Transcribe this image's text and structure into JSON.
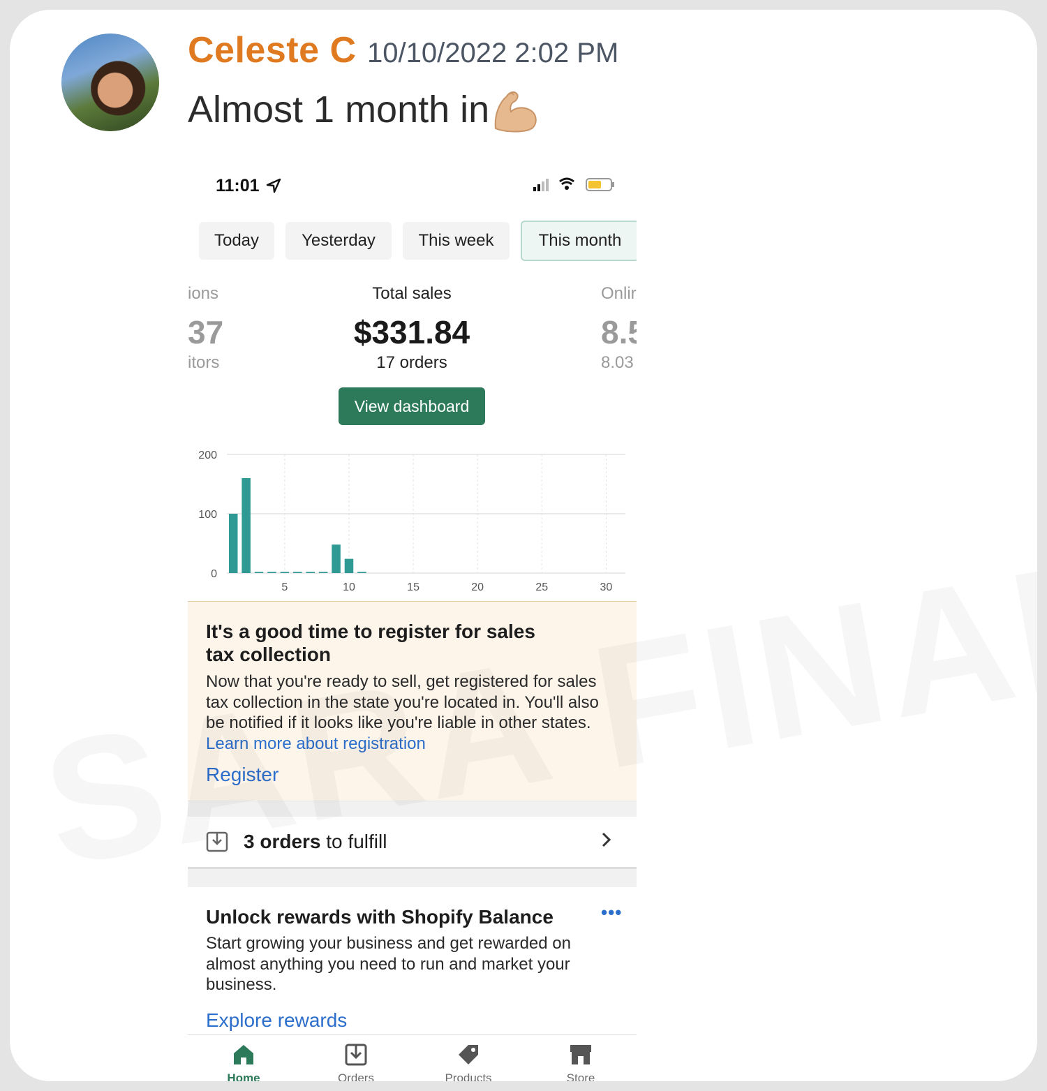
{
  "post": {
    "author": "Celeste C",
    "timestamp": "10/10/2022 2:02 PM",
    "message": "Almost 1 month in"
  },
  "watermark": "SARA FINANCE",
  "phone": {
    "status_bar": {
      "time": "11:01"
    },
    "date_filters": [
      "Today",
      "Yesterday",
      "This week",
      "This month"
    ],
    "active_filter": "This month",
    "metrics": {
      "left": {
        "label": "ions",
        "value": "37",
        "sub": "itors"
      },
      "center": {
        "label": "Total sales",
        "value": "$331.84",
        "sub": "17 orders"
      },
      "right": {
        "label": "Onlir",
        "value": "8.5",
        "sub": "8.03"
      }
    },
    "view_dashboard_label": "View dashboard",
    "tax_card": {
      "title": "It's a good time to register for sales tax collection",
      "body": "Now that you're ready to sell, get registered for sales tax collection in the state you're located in. You'll also be notified if it looks like you're liable in other states.",
      "learn_more": "Learn more about registration",
      "register": "Register"
    },
    "fulfill": {
      "count_text": "3 orders",
      "rest_text": " to fulfill"
    },
    "rewards": {
      "title": "Unlock rewards with Shopify Balance",
      "body": "Start growing your business and get rewarded on almost anything you need to run and market your business.",
      "link": "Explore rewards",
      "menu": "•••"
    },
    "tabs": [
      "Home",
      "Orders",
      "Products",
      "Store"
    ],
    "active_tab": "Home"
  },
  "colors": {
    "author": "#e07a21",
    "accent_green": "#2d7a5a",
    "bar": "#2f9a94",
    "link": "#2c6ecb",
    "tax_card_bg": "#fdf4ea"
  },
  "icons": [
    "location-arrow-icon",
    "signal-icon",
    "wifi-icon",
    "battery-icon",
    "flexed-biceps-icon",
    "download-box-icon",
    "chevron-right-icon",
    "home-icon",
    "orders-icon",
    "tag-icon",
    "store-icon"
  ],
  "chart_data": {
    "type": "bar",
    "x": [
      1,
      2,
      3,
      4,
      5,
      6,
      7,
      8,
      9,
      10,
      11,
      12,
      13,
      14,
      15,
      16,
      17,
      18,
      19,
      20,
      21,
      22,
      23,
      24,
      25,
      26,
      27,
      28,
      29,
      30,
      31
    ],
    "values": [
      100,
      160,
      2,
      2,
      2,
      2,
      2,
      2,
      48,
      24,
      2,
      0,
      0,
      0,
      0,
      0,
      0,
      0,
      0,
      0,
      0,
      0,
      0,
      0,
      0,
      0,
      0,
      0,
      0,
      0,
      0
    ],
    "xticks": [
      5,
      10,
      15,
      20,
      25,
      30
    ],
    "yticks": [
      0,
      100,
      200
    ],
    "ylim": [
      0,
      200
    ],
    "xlim": [
      0.5,
      31.5
    ],
    "grid": true,
    "title": "",
    "xlabel": "",
    "ylabel": ""
  }
}
